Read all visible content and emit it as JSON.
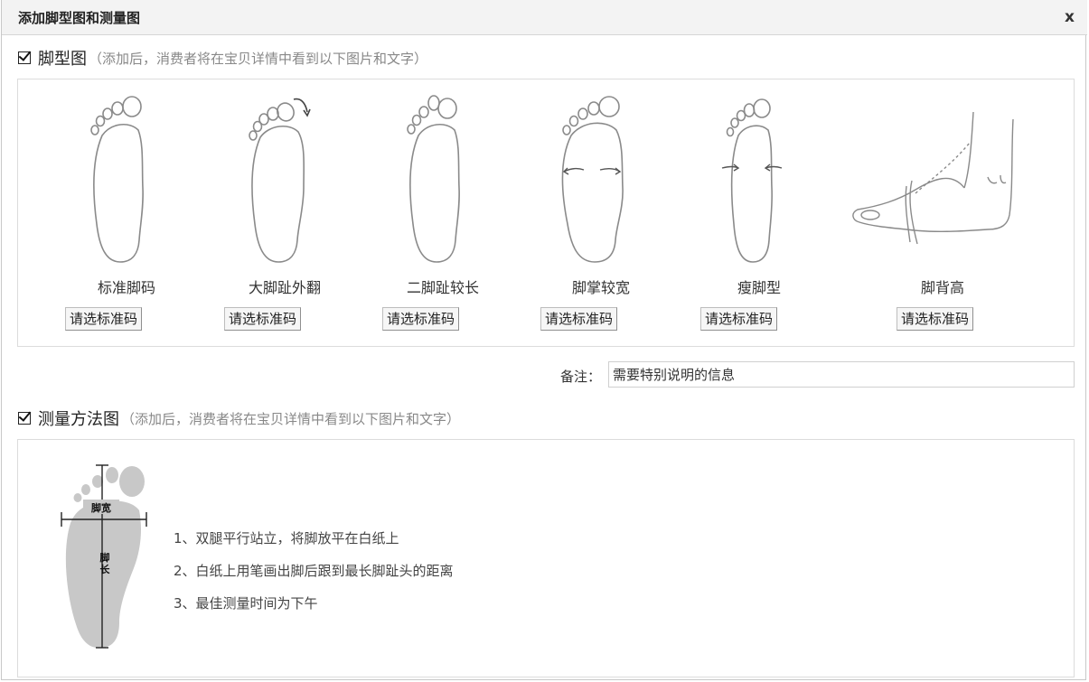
{
  "dialog": {
    "title": "添加脚型图和测量图",
    "close_label": "x"
  },
  "foot_type": {
    "title": "脚型图",
    "note": "（添加后，消费者将在宝贝详情中看到以下图片和文字）",
    "items": [
      {
        "label": "标准脚码",
        "button": "请选标准码"
      },
      {
        "label": "大脚趾外翻",
        "button": "请选标准码"
      },
      {
        "label": "二脚趾较长",
        "button": "请选标准码"
      },
      {
        "label": "脚掌较宽",
        "button": "请选标准码"
      },
      {
        "label": "瘦脚型",
        "button": "请选标准码"
      },
      {
        "label": "脚背高",
        "button": "请选标准码"
      }
    ]
  },
  "remark": {
    "label": "备注：",
    "value": "需要特别说明的信息"
  },
  "measure": {
    "title": "测量方法图",
    "note": "（添加后，消费者将在宝贝详情中看到以下图片和文字）",
    "diagram": {
      "width_label": "脚宽",
      "length_label": "脚长"
    },
    "steps": [
      "1、双腿平行站立，将脚放平在白纸上",
      "2、白纸上用笔画出脚后跟到最长脚趾头的距离",
      "3、最佳测量时间为下午"
    ]
  }
}
